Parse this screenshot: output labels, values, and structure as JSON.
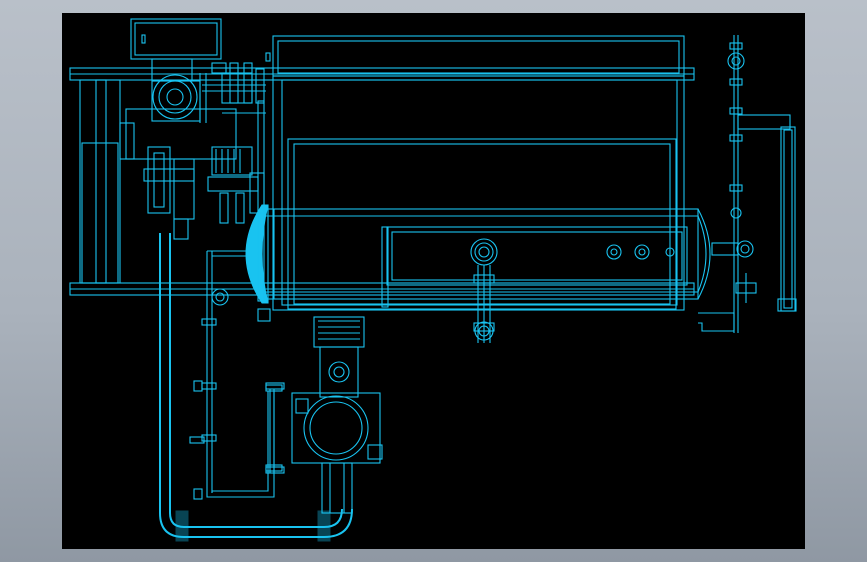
{
  "drawing": {
    "background_color": "#000000",
    "line_color": "#19c3f0",
    "frame_color": "#aab2bc"
  }
}
